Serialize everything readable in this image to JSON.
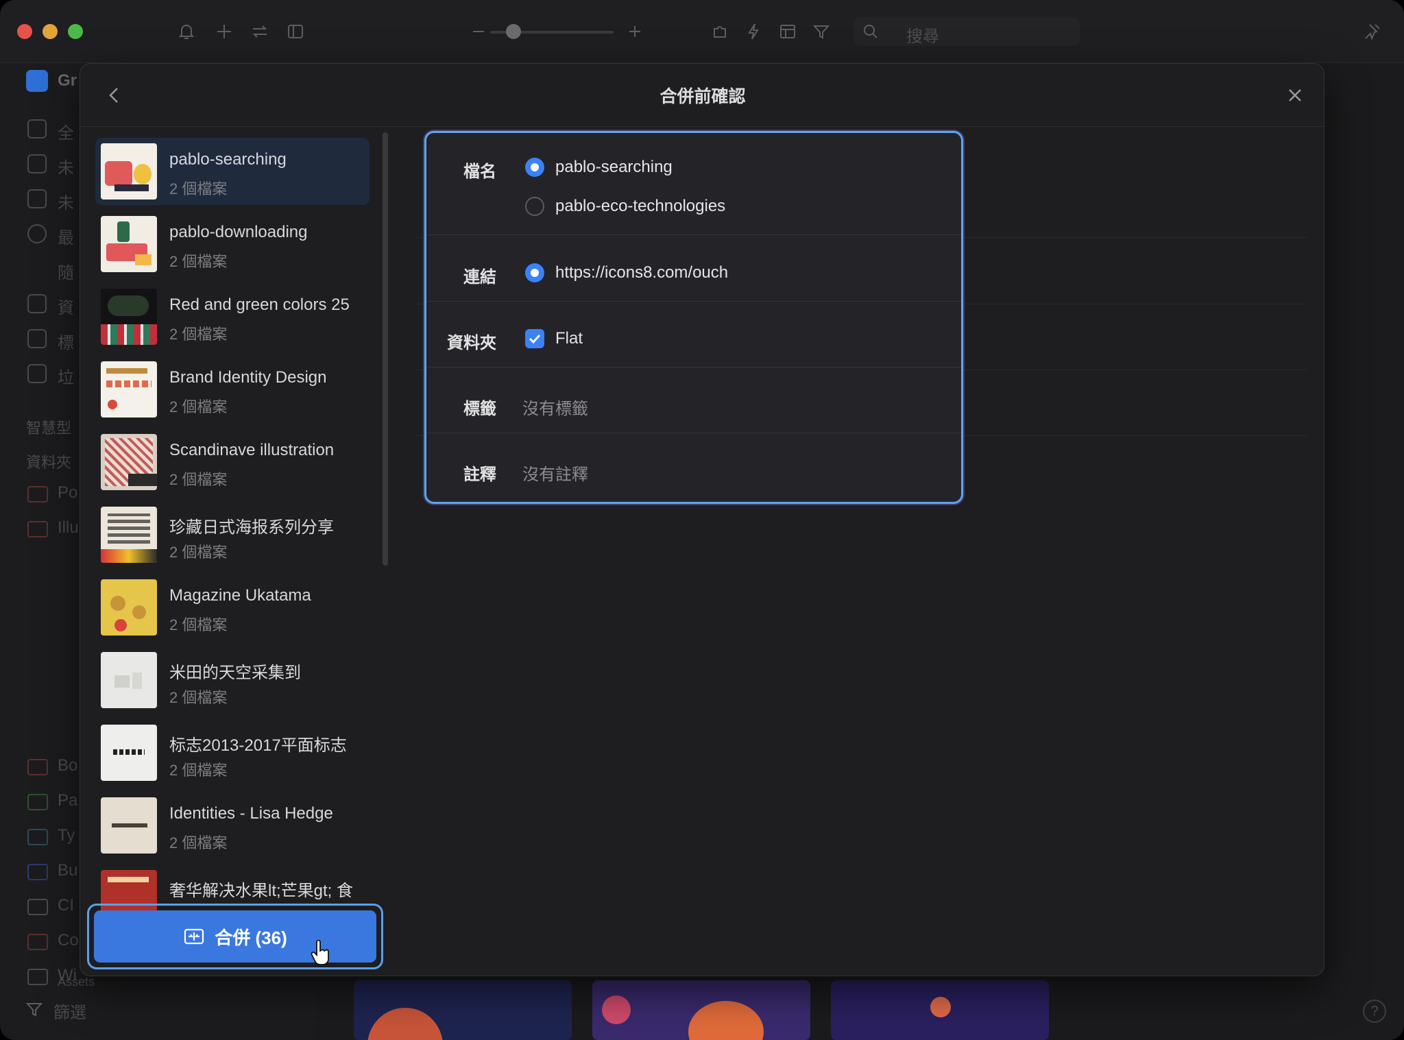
{
  "app": {
    "search_placeholder": "搜尋",
    "sidebar_partial": [
      "Gr",
      "全",
      "未",
      "未",
      "最",
      "隨",
      "資",
      "標",
      "垃",
      "智慧型",
      "資料夾",
      "Po",
      "Illu",
      "Bo",
      "Pa",
      "Ty",
      "Bu",
      "CI",
      "Co",
      "Wi",
      "Assets"
    ],
    "footer_filter_label": "篩選",
    "help_label": "?"
  },
  "modal": {
    "title": "合併前確認",
    "items": [
      {
        "name": "pablo-searching",
        "count": "2 個檔案",
        "selected": true
      },
      {
        "name": "pablo-downloading",
        "count": "2 個檔案"
      },
      {
        "name": "Red and green colors 25",
        "count": "2 個檔案"
      },
      {
        "name": "Brand Identity Design",
        "count": "2 個檔案"
      },
      {
        "name": "Scandinave illustration",
        "count": "2 個檔案"
      },
      {
        "name": "珍藏日式海报系列分享",
        "count": "2 個檔案"
      },
      {
        "name": "Magazine Ukatama",
        "count": "2 個檔案"
      },
      {
        "name": "米田的天空采集到",
        "count": "2 個檔案"
      },
      {
        "name": "标志2013-2017平面标志",
        "count": "2 個檔案"
      },
      {
        "name": "Identities - Lisa Hedge",
        "count": "2 個檔案"
      },
      {
        "name": "奢华解决水果lt;芒果gt; 食",
        "count": ""
      }
    ],
    "merge_button_label": "合併 (36)",
    "details": {
      "filename_label": "檔名",
      "filename_options": [
        "pablo-searching",
        "pablo-eco-technologies"
      ],
      "filename_selected": "pablo-searching",
      "link_label": "連結",
      "link_value": "https://icons8.com/ouch",
      "folder_label": "資料夾",
      "folder_value": "Flat",
      "folder_checked": true,
      "tags_label": "標籤",
      "tags_value": "沒有標籤",
      "notes_label": "註釋",
      "notes_value": "沒有註釋"
    }
  },
  "colors": {
    "accent": "#3a82f6",
    "merge_button": "#3a78e0",
    "panel_outline": "#5aa6f2",
    "selected_row": "#1f2b3d"
  }
}
